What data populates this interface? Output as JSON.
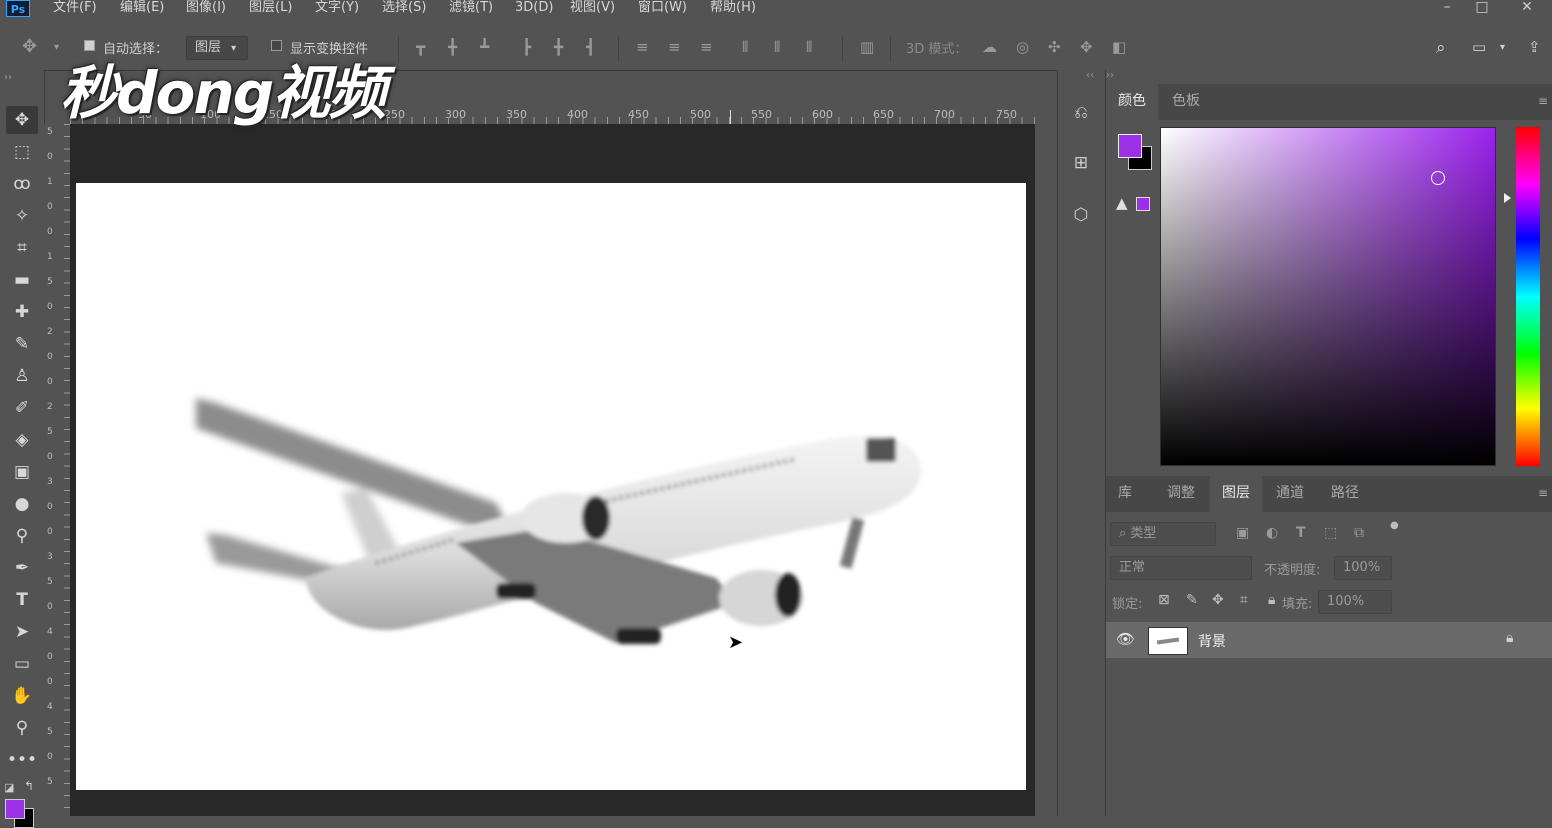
{
  "menubar": {
    "app_icon": "Ps",
    "items": [
      "文件(F)",
      "编辑(E)",
      "图像(I)",
      "图层(L)",
      "文字(Y)",
      "选择(S)",
      "滤镜(T)",
      "3D(D)",
      "视图(V)",
      "窗口(W)",
      "帮助(H)"
    ],
    "window_controls": [
      "–",
      "□",
      "✕"
    ]
  },
  "options": {
    "auto_select_label": "自动选择：",
    "auto_select_target": "图层",
    "show_transform_label": "显示变换控件",
    "mode_3d_label": "3D 模式："
  },
  "watermark": "秒dong视频",
  "ruler": {
    "top_labels": [
      "50",
      "100",
      "150",
      "200",
      "250",
      "300",
      "350",
      "400",
      "450",
      "500",
      "550",
      "600",
      "650",
      "700",
      "750"
    ],
    "left_labels": [
      "5",
      "0",
      "1",
      "0",
      "0",
      "1",
      "5",
      "0",
      "2",
      "0",
      "0",
      "2",
      "5",
      "0",
      "3",
      "0",
      "0",
      "3",
      "5",
      "0",
      "4",
      "0",
      "0",
      "4",
      "5",
      "0",
      "5"
    ]
  },
  "color_panel": {
    "tabs": [
      "颜色",
      "色板"
    ],
    "foreground": "#9b30e6",
    "background": "#000000",
    "warning_icon": "gamut-warning-icon",
    "selected_hue": "#9b22ee"
  },
  "layers_panel": {
    "tabs": [
      "库",
      "调整",
      "图层",
      "通道",
      "路径"
    ],
    "filter_placeholder": "类型",
    "blend_mode": "正常",
    "opacity_label": "不透明度:",
    "opacity_value": "100%",
    "lock_label": "锁定:",
    "fill_label": "填充:",
    "fill_value": "100%",
    "layers": [
      {
        "name": "背景",
        "visible": true,
        "locked": true
      }
    ]
  }
}
